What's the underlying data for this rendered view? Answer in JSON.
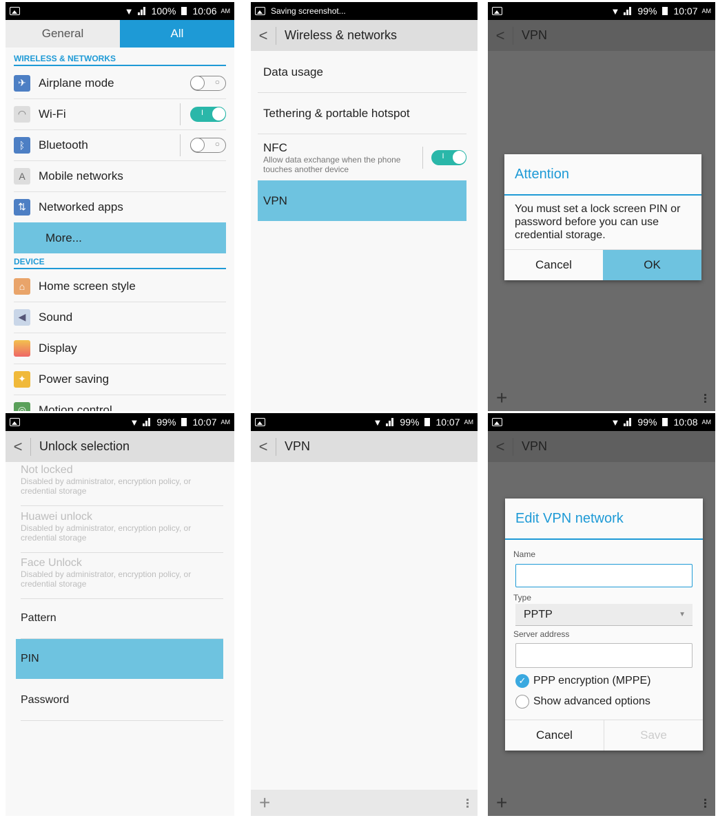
{
  "status": {
    "p1": {
      "battery": "100%",
      "time": "10:06",
      "ampm": "AM"
    },
    "p2": {
      "text": "Saving screenshot..."
    },
    "p3": {
      "battery": "99%",
      "time": "10:07",
      "ampm": "AM"
    },
    "p4": {
      "battery": "99%",
      "time": "10:07",
      "ampm": "AM"
    },
    "p5": {
      "battery": "99%",
      "time": "10:07",
      "ampm": "AM"
    },
    "p6": {
      "battery": "99%",
      "time": "10:08",
      "ampm": "AM"
    }
  },
  "settings": {
    "tabs": [
      "General",
      "All"
    ],
    "section_wireless": "WIRELESS & NETWORKS",
    "airplane": "Airplane mode",
    "wifi": "Wi-Fi",
    "bluetooth": "Bluetooth",
    "mobile": "Mobile networks",
    "networked": "Networked apps",
    "more": "More...",
    "section_device": "DEVICE",
    "home": "Home screen style",
    "sound": "Sound",
    "display": "Display",
    "power": "Power saving",
    "motion": "Motion control"
  },
  "wireless": {
    "title": "Wireless & networks",
    "data_usage": "Data usage",
    "tethering": "Tethering & portable hotspot",
    "nfc": "NFC",
    "nfc_sub": "Allow data exchange when the phone touches another device",
    "vpn": "VPN"
  },
  "vpn": {
    "title": "VPN"
  },
  "attention": {
    "title": "Attention",
    "message": "You must set a lock screen PIN or password before you can use credential storage.",
    "cancel": "Cancel",
    "ok": "OK"
  },
  "unlock": {
    "title": "Unlock selection",
    "not_locked": "Not locked",
    "huawei": "Huawei unlock",
    "face": "Face Unlock",
    "disabled_note": "Disabled by administrator, encryption policy, or credential storage",
    "pattern": "Pattern",
    "pin": "PIN",
    "password": "Password"
  },
  "edit_vpn": {
    "title": "Edit VPN network",
    "name_label": "Name",
    "type_label": "Type",
    "type_value": "PPTP",
    "server_label": "Server address",
    "ppp": "PPP encryption (MPPE)",
    "advanced": "Show advanced options",
    "cancel": "Cancel",
    "save": "Save"
  }
}
